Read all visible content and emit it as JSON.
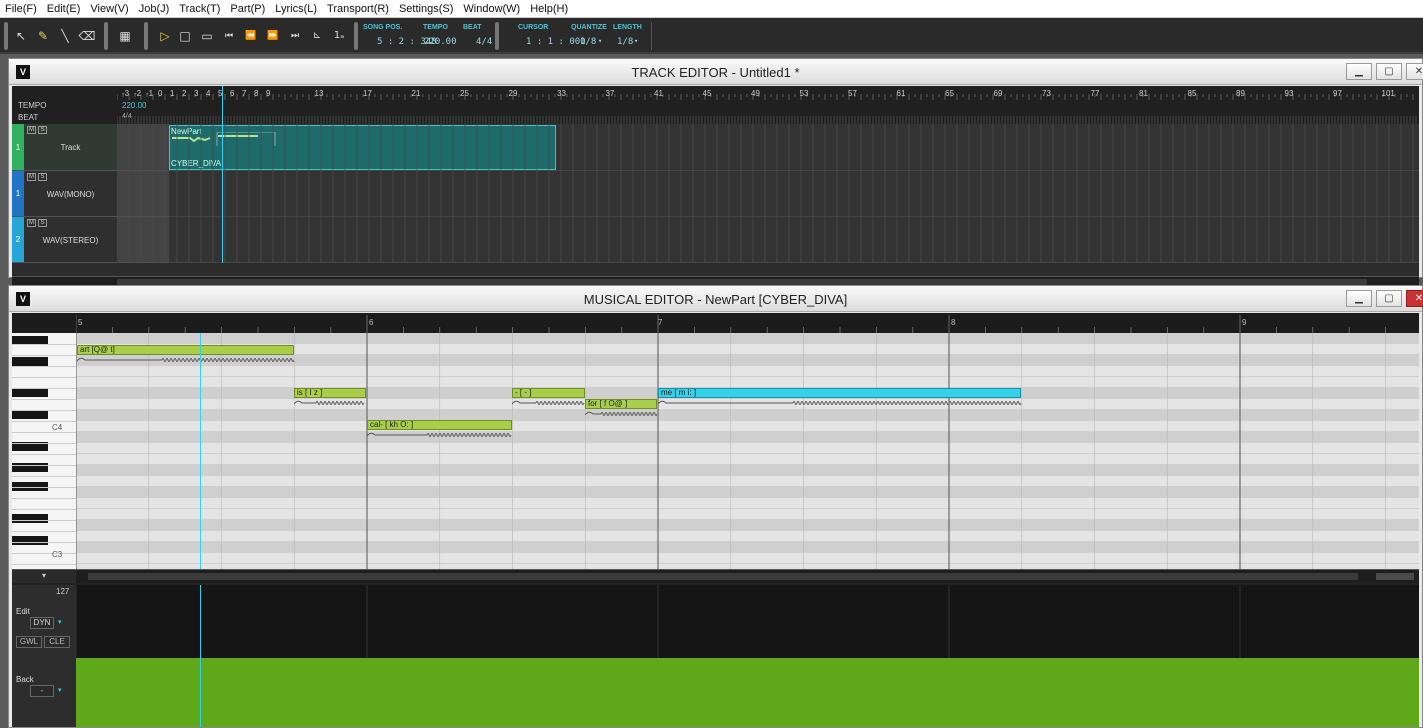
{
  "menu": [
    "File(F)",
    "Edit(E)",
    "View(V)",
    "Job(J)",
    "Track(T)",
    "Part(P)",
    "Lyrics(L)",
    "Transport(R)",
    "Settings(S)",
    "Window(W)",
    "Help(H)"
  ],
  "toolbar": {
    "song_pos_label": "SONG POS.",
    "song_pos_value": "5 : 2 : 348",
    "tempo_label": "TEMPO",
    "tempo_value": "220.00",
    "beat_label": "BEAT",
    "beat_value": "4/4",
    "cursor_label": "CURSOR",
    "cursor_value": "1 : 1 : 000",
    "quantize_label": "QUANTIZE",
    "quantize_value": "1/8",
    "length_label": "LENGTH",
    "length_value": "1/8"
  },
  "track_editor": {
    "logo": "V",
    "title": "TRACK EDITOR - Untitled1 *",
    "tempo_label": "TEMPO",
    "beat_label": "BEAT",
    "tempo_value": "220.00",
    "beat_value": "4/4",
    "ruler": [
      "-3",
      "-2",
      "-1",
      "0",
      "1",
      "2",
      "3",
      "4",
      "5",
      "6",
      "7",
      "8",
      "9",
      "13",
      "17",
      "21",
      "25",
      "29",
      "33",
      "37",
      "41",
      "45",
      "49",
      "53",
      "57",
      "61",
      "65",
      "69",
      "73",
      "77",
      "81",
      "85",
      "89",
      "93",
      "97",
      "101"
    ],
    "tracks": [
      {
        "num": "1",
        "name": "Track",
        "ms": [
          "M",
          "S"
        ]
      },
      {
        "num": "1",
        "name": "WAV(MONO)",
        "ms": [
          "M",
          "S"
        ]
      },
      {
        "num": "2",
        "name": "WAV(STEREO)",
        "ms": [
          "M",
          "S"
        ]
      }
    ],
    "part": {
      "name": "NewPart",
      "singer": "CYBER_DIVA"
    }
  },
  "musical_editor": {
    "logo": "V",
    "title": "MUSICAL EDITOR - NewPart [CYBER_DIVA]",
    "bars": [
      "5",
      "6",
      "7",
      "8",
      "9"
    ],
    "octave_labels": [
      "C4",
      "C3"
    ],
    "notes": [
      {
        "lyric": "art [Q@ t]"
      },
      {
        "lyric": "is [ I z ]"
      },
      {
        "lyric": "cal- [ kh O: ]"
      },
      {
        "lyric": "- [ - ]"
      },
      {
        "lyric": "for [ f O@ ]"
      },
      {
        "lyric": "me [ m i: ]"
      }
    ],
    "controls": {
      "max_value": "127",
      "edit_label": "Edit",
      "param": "DYN",
      "buttons": [
        "GWL",
        "CLE"
      ],
      "back_label": "Back",
      "back_value": "-"
    }
  },
  "colors": {
    "note": "#a9cf4a",
    "selected_note": "#35d1ea",
    "control_fill": "#5ea81a",
    "cursor": "#35d1ea"
  }
}
